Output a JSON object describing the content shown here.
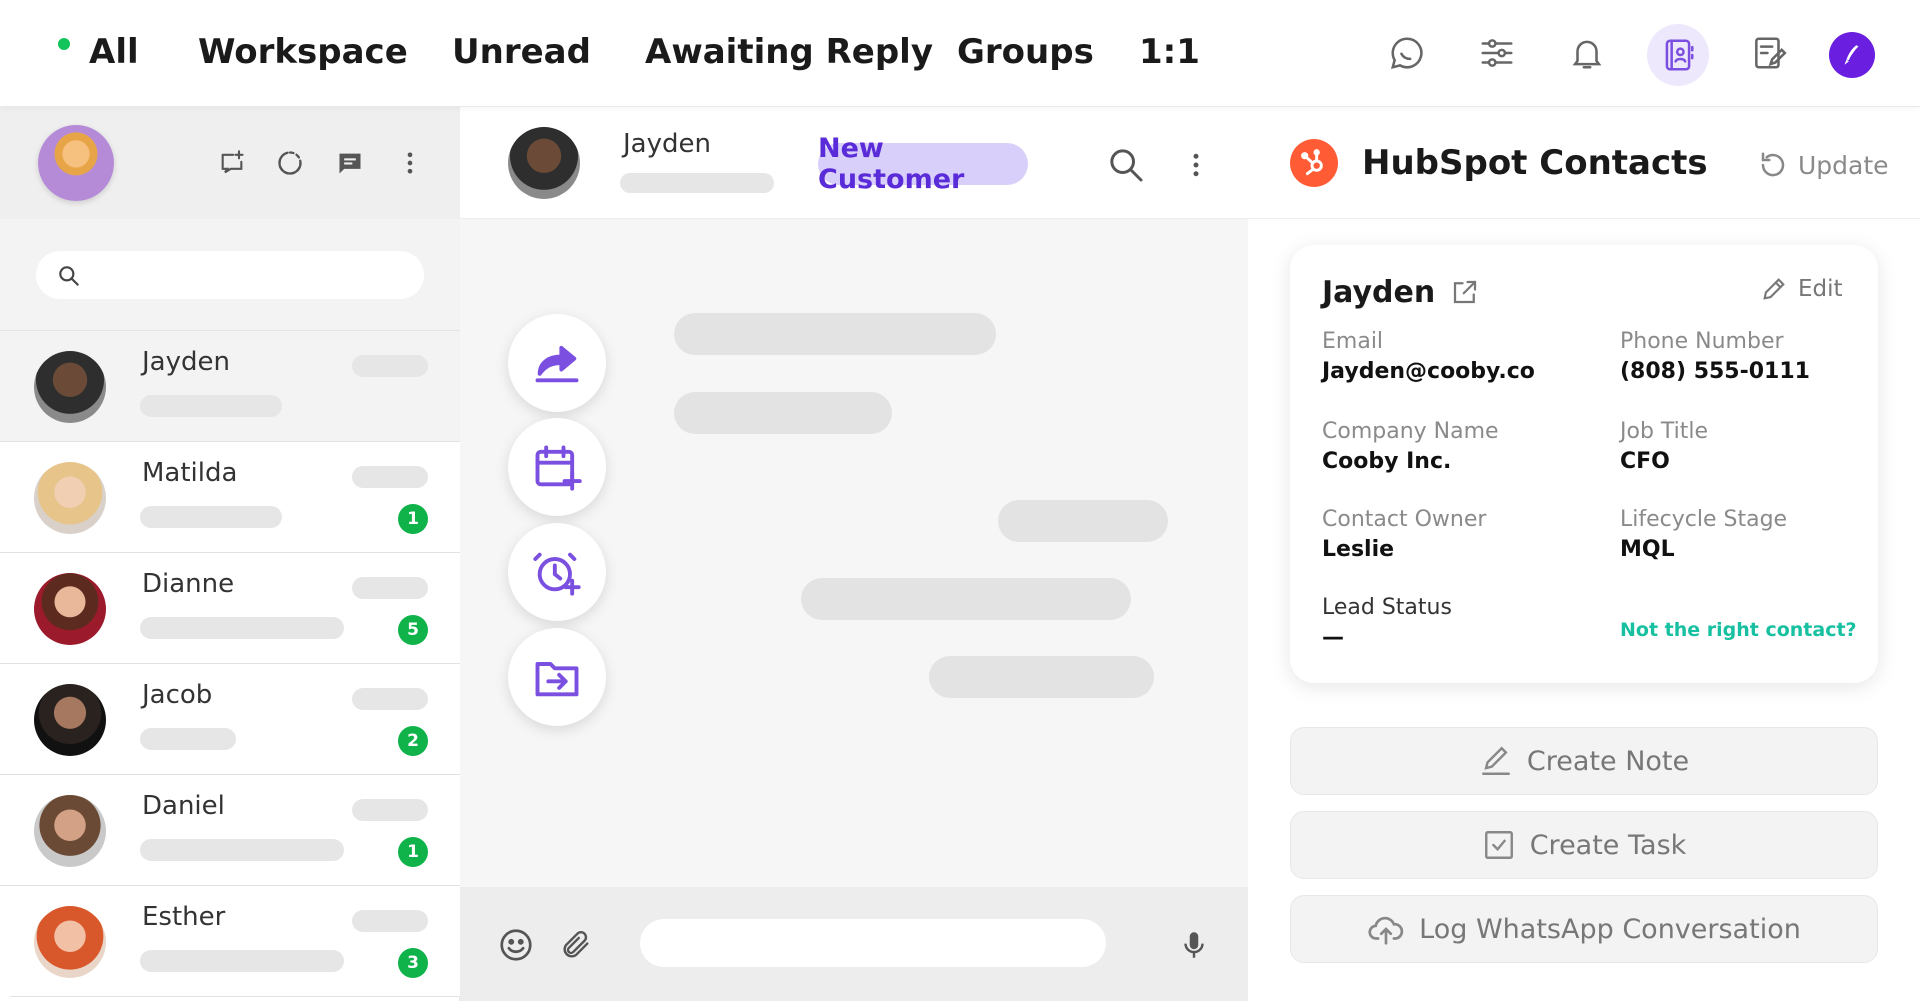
{
  "topnav": {
    "tabs": [
      "All",
      "Workspace",
      "Unread",
      "Awaiting Reply",
      "Groups",
      "1:1"
    ],
    "icons": [
      "whatsapp-icon",
      "filters-icon",
      "bell-icon",
      "contacts-book-icon",
      "edit-note-icon",
      "brand-avatar-icon"
    ],
    "active_indicator_color": "#14c45a",
    "active_icon_bg": "#ede8fb"
  },
  "left_panel": {
    "header_icons": [
      "new-chat-icon",
      "status-icon",
      "message-icon",
      "more-vertical-icon"
    ],
    "search": {
      "placeholder": "",
      "value": ""
    },
    "contacts": [
      {
        "name": "Jayden",
        "badge": null,
        "selected": true
      },
      {
        "name": "Matilda",
        "badge": "1",
        "selected": false
      },
      {
        "name": "Dianne",
        "badge": "5",
        "selected": false
      },
      {
        "name": "Jacob",
        "badge": "2",
        "selected": false
      },
      {
        "name": "Daniel",
        "badge": "1",
        "selected": false
      },
      {
        "name": "Esther",
        "badge": "3",
        "selected": false
      }
    ],
    "badge_color": "#0fb34a"
  },
  "chat": {
    "name": "Jayden",
    "tag": "New Customer",
    "tag_color": "#5a2bd8",
    "tag_bg": "#d9cffb",
    "quick_actions": [
      "share-icon",
      "calendar-add-icon",
      "alarm-add-icon",
      "folder-move-icon"
    ],
    "footer_icons": [
      "emoji-icon",
      "attachment-icon",
      "microphone-icon"
    ],
    "message_input": {
      "placeholder": "",
      "value": ""
    }
  },
  "hubspot": {
    "title": "HubSpot Contacts",
    "update_label": "Update",
    "brand_color": "#ff5c35",
    "contact": {
      "name": "Jayden",
      "edit_label": "Edit",
      "fields": [
        {
          "label": "Email",
          "value": "Jayden@cooby.co"
        },
        {
          "label": "Phone Number",
          "value": "(808) 555-0111"
        },
        {
          "label": "Company Name",
          "value": "Cooby Inc."
        },
        {
          "label": "Job Title",
          "value": "CFO"
        },
        {
          "label": "Contact Owner",
          "value": "Leslie"
        },
        {
          "label": "Lifecycle Stage",
          "value": "MQL"
        },
        {
          "label": "Lead Status",
          "value": "—"
        }
      ],
      "not_right_contact": "Not the right contact?"
    },
    "actions": [
      "Create Note",
      "Create Task",
      "Log WhatsApp Conversation"
    ],
    "link_color": "#17c0a0"
  }
}
